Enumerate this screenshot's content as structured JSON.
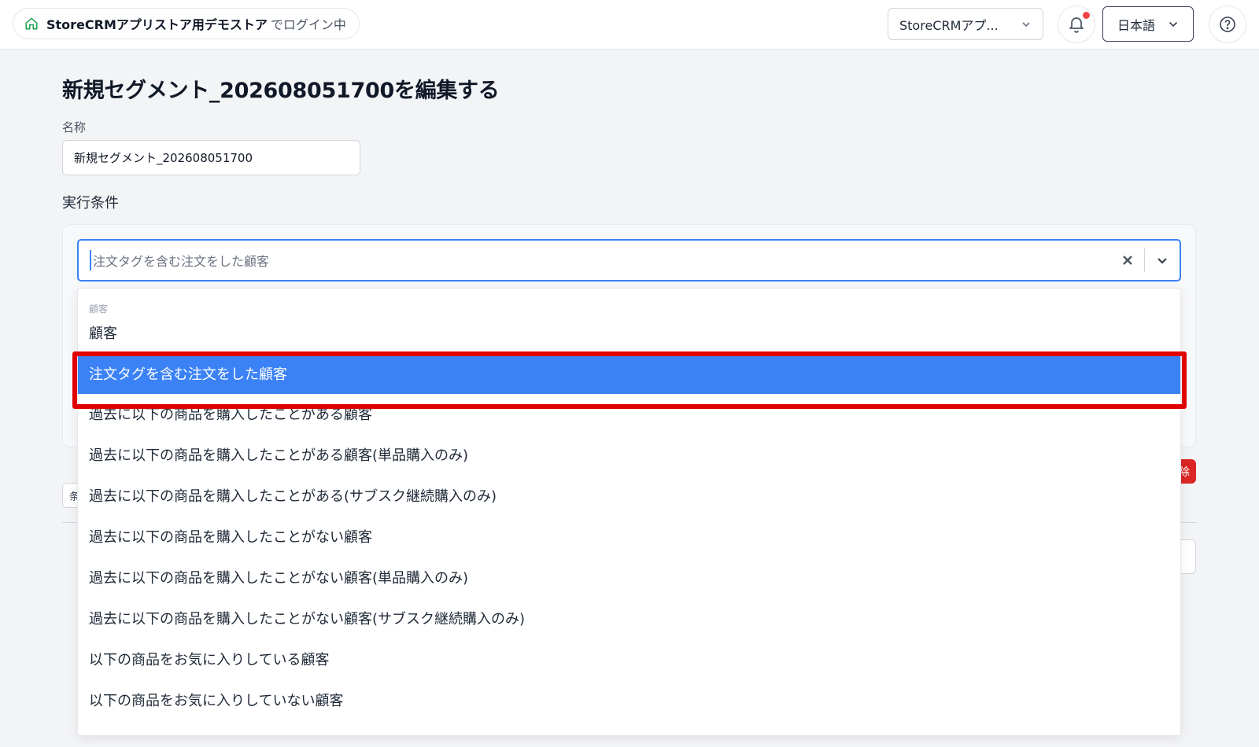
{
  "header": {
    "store_name": "StoreCRMアプリストア用デモストア",
    "store_suffix": "でログイン中",
    "store_select_label": "StoreCRMアプ...",
    "language_label": "日本語",
    "notification_dot_color": "#ef4444"
  },
  "page": {
    "title": "新規セグメント_202608051700を編集する",
    "name_label": "名称",
    "name_value": "新規セグメント_202608051700",
    "conditions_label": "実行条件"
  },
  "condition": {
    "selected_value": "注文タグを含む注文をした顧客",
    "accent_color": "#3b82f6"
  },
  "background": {
    "delete_label_fragment": "除",
    "condition_button_fragment": "条"
  },
  "menu": {
    "group_label": "顧客",
    "options": [
      "顧客",
      "注文タグを含む注文をした顧客",
      "過去に以下の商品を購入したことがある顧客",
      "過去に以下の商品を購入したことがある顧客(単品購入のみ)",
      "過去に以下の商品を購入したことがある(サブスク継続購入のみ)",
      "過去に以下の商品を購入したことがない顧客",
      "過去に以下の商品を購入したことがない顧客(単品購入のみ)",
      "過去に以下の商品を購入したことがない顧客(サブスク継続購入のみ)",
      "以下の商品をお気に入りしている顧客",
      "以下の商品をお気に入りしていない顧客"
    ],
    "selected_index": 1,
    "highlight_color": "#e00000"
  }
}
